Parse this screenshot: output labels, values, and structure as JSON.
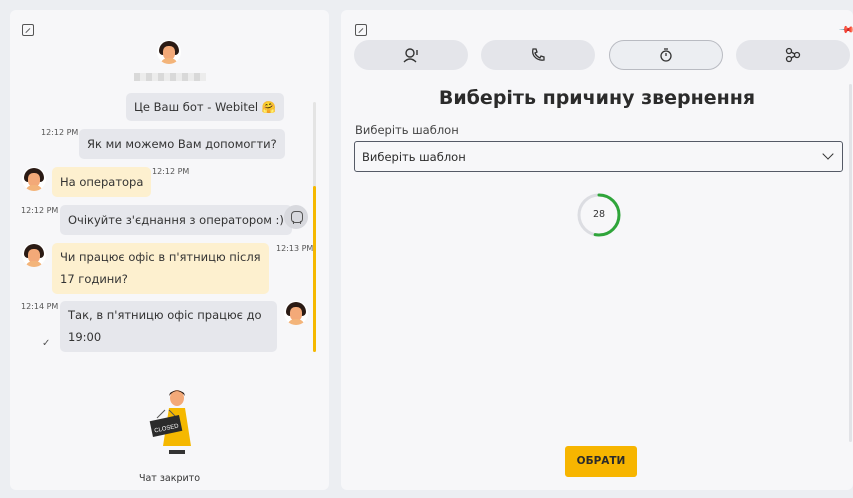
{
  "left_panel": {
    "chat_closed_label": "Чат закрито",
    "messages": [
      {
        "text": "Це Ваш бот - Webitel 🤗",
        "time": ""
      },
      {
        "text": "Як ми можемо Вам допомогти?",
        "time": "12:12 PM"
      },
      {
        "text": "На оператора",
        "time": "12:12 PM"
      },
      {
        "text": "Очікуйте з'єднання з оператором :)",
        "time": "12:12 PM"
      },
      {
        "text_line1": "Чи працює офіс в п'ятницю після",
        "text_line2": "17 години?",
        "time": "12:13 PM"
      },
      {
        "text_line1": "Так, в п'ятницю офіс працює до",
        "text_line2": "19:00",
        "time": "12:14 PM"
      }
    ],
    "closed_sign_text": "CLOSED"
  },
  "right_panel": {
    "tabs": [
      {
        "icon": "agent-icon"
      },
      {
        "icon": "phone-icon"
      },
      {
        "icon": "timer-icon",
        "active": true
      },
      {
        "icon": "flow-icon"
      }
    ],
    "title": "Виберіть причину звернення",
    "template_label": "Виберіть шаблон",
    "template_value": "Виберіть шаблон",
    "timer_value": "28",
    "timer_progress": 0.53,
    "select_button": "ОБРАТИ"
  },
  "colors": {
    "accent": "#f5b800",
    "user_bubble": "#fdf0cf",
    "bot_bubble": "#e6e7ec",
    "timer_green": "#2fa53a"
  }
}
